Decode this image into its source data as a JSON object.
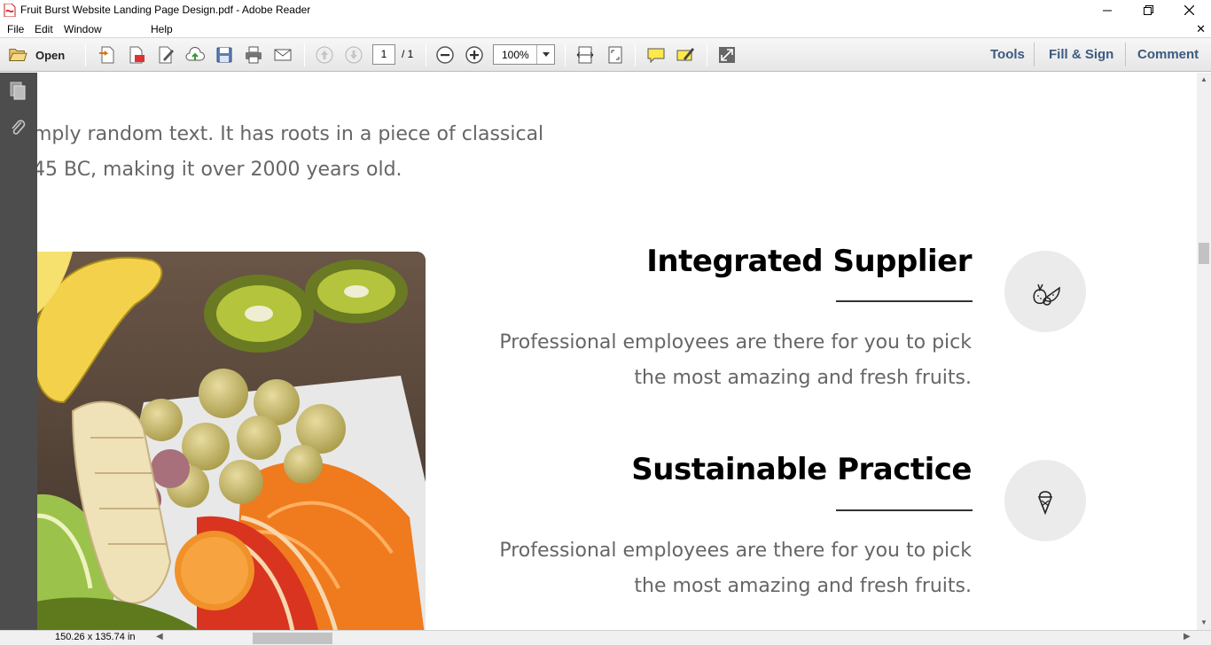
{
  "window": {
    "title": "Fruit Burst Website Landing Page Design.pdf - Adobe Reader",
    "minimize_glyph": "—",
    "doc_close_glyph": "✕"
  },
  "menu": [
    "File",
    "Edit",
    "Window",
    "Help"
  ],
  "toolbar": {
    "open_label": "Open",
    "page_current": "1",
    "page_total": "/ 1",
    "zoom": "100%",
    "tools_label": "Tools",
    "fill_sign_label": "Fill & Sign",
    "comment_label": "Comment",
    "icons": [
      "open-folder-icon",
      "create-pdf-icon",
      "export-pdf-icon",
      "edit-pdf-icon",
      "upload-cloud-icon",
      "save-icon",
      "print-icon",
      "email-icon",
      "previous-page-icon",
      "next-page-icon",
      "zoom-out-icon",
      "zoom-in-icon",
      "fit-width-icon",
      "fit-page-icon",
      "sticky-note-icon",
      "highlight-icon",
      "full-screen-icon"
    ]
  },
  "document": {
    "intro_lines": [
      "mply random text. It has roots in a piece of classical",
      "45 BC, making it over 2000 years old."
    ],
    "features": [
      {
        "title": "Integrated Supplier",
        "desc_line1": "Professional employees are there for you to pick",
        "desc_line2": "the most amazing and fresh fruits.",
        "icon": "fruits-icon"
      },
      {
        "title": "Sustainable Practice",
        "desc_line1": "Professional employees are there for you to pick",
        "desc_line2": "the most amazing and fresh fruits.",
        "icon": "ice-cream-icon"
      }
    ]
  },
  "status": {
    "page_size": "150.26 x 135.74 in"
  },
  "colors": {
    "accent_blue": "#3c5a80",
    "nav_pane": "#4d4d4d",
    "circle_bg": "#ebebeb",
    "text_gray": "#666666"
  }
}
